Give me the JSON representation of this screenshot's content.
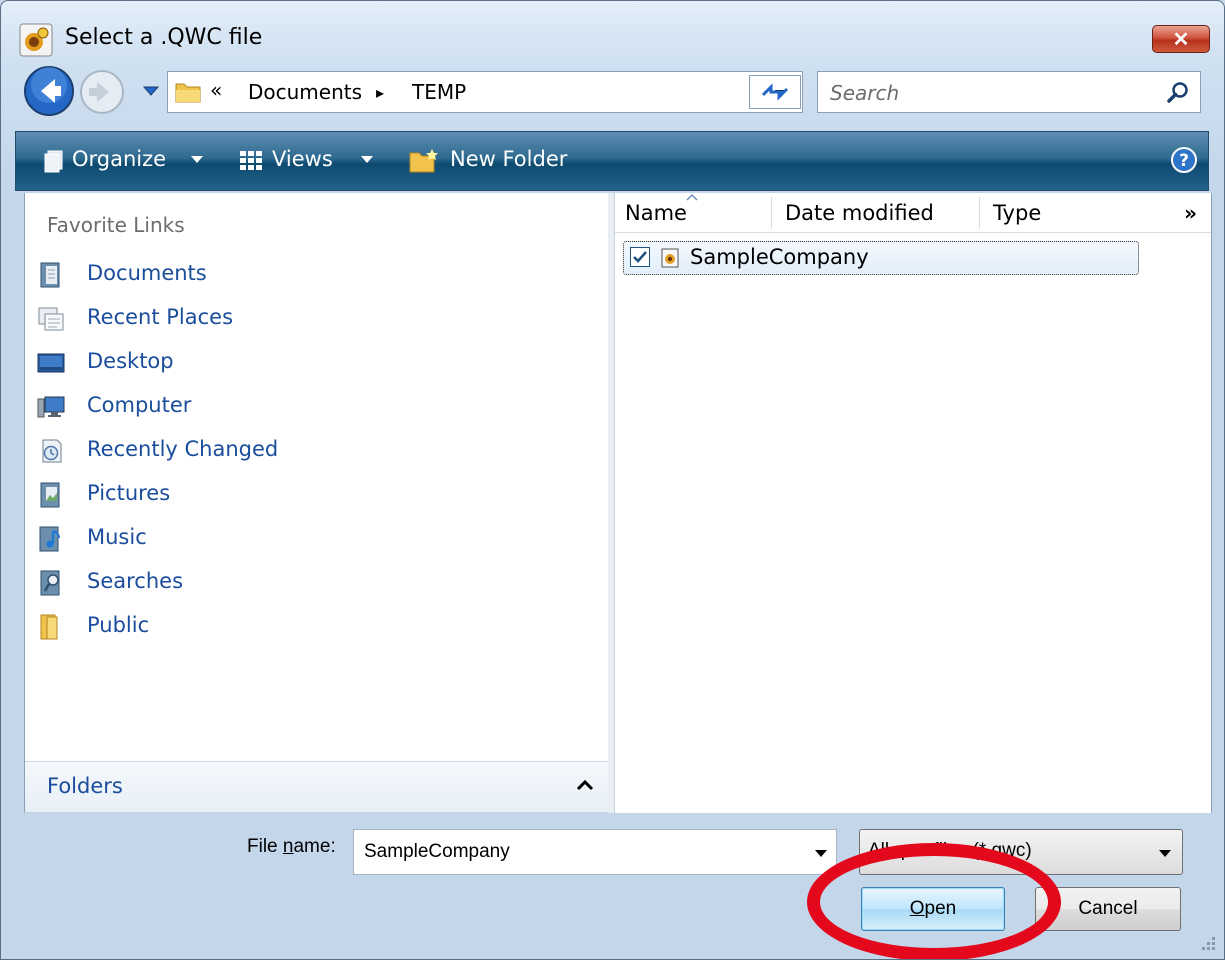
{
  "window": {
    "title": "Select a .QWC file"
  },
  "address_bar": {
    "segments": [
      "«",
      "Documents",
      "▸",
      "TEMP"
    ]
  },
  "search": {
    "placeholder": "Search"
  },
  "toolbar": {
    "organize": "Organize",
    "views": "Views",
    "new_folder": "New Folder"
  },
  "favorites": {
    "heading": "Favorite Links",
    "items": [
      {
        "label": "Documents",
        "icon": "documents-icon"
      },
      {
        "label": "Recent Places",
        "icon": "recent-places-icon"
      },
      {
        "label": "Desktop",
        "icon": "desktop-icon"
      },
      {
        "label": "Computer",
        "icon": "computer-icon"
      },
      {
        "label": "Recently Changed",
        "icon": "recently-changed-icon"
      },
      {
        "label": "Pictures",
        "icon": "pictures-icon"
      },
      {
        "label": "Music",
        "icon": "music-icon"
      },
      {
        "label": "Searches",
        "icon": "searches-icon"
      },
      {
        "label": "Public",
        "icon": "public-folder-icon"
      }
    ],
    "folders_label": "Folders"
  },
  "file_list": {
    "columns": [
      "Name",
      "Date modified",
      "Type"
    ],
    "more": "»",
    "rows": [
      {
        "name": "SampleCompany",
        "checked": true
      }
    ]
  },
  "bottom": {
    "file_name_label_prefix": "File ",
    "file_name_label_accel": "n",
    "file_name_label_suffix": "ame:",
    "file_name_value": "SampleCompany",
    "file_type_value": "All qwc files (*.qwc)",
    "open_accel": "O",
    "open_rest": "pen",
    "cancel_label": "Cancel"
  },
  "colors": {
    "toolbar": "#0e4a70",
    "link": "#1a4d9c",
    "annotation_ring": "#e3081b"
  }
}
